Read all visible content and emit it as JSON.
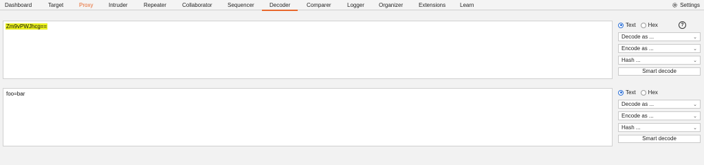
{
  "nav": {
    "tabs": [
      {
        "label": "Dashboard"
      },
      {
        "label": "Target"
      },
      {
        "label": "Proxy"
      },
      {
        "label": "Intruder"
      },
      {
        "label": "Repeater"
      },
      {
        "label": "Collaborator"
      },
      {
        "label": "Sequencer"
      },
      {
        "label": "Decoder"
      },
      {
        "label": "Comparer"
      },
      {
        "label": "Logger"
      },
      {
        "label": "Organizer"
      },
      {
        "label": "Extensions"
      },
      {
        "label": "Learn"
      }
    ],
    "active_tab": "Decoder",
    "settings_label": "Settings"
  },
  "colors": {
    "accent": "#e8672b",
    "highlight": "#e8ef1d",
    "radio": "#2b6fd6"
  },
  "panels": [
    {
      "content": "Zm9vPWJhcg==",
      "content_highlighted": true,
      "text_label": "Text",
      "hex_label": "Hex",
      "selected_mode": "Text",
      "help_label": "?",
      "decode_label": "Decode as ...",
      "encode_label": "Encode as ...",
      "hash_label": "Hash ...",
      "smart_decode_label": "Smart decode"
    },
    {
      "content": "foo=bar",
      "content_highlighted": false,
      "text_label": "Text",
      "hex_label": "Hex",
      "selected_mode": "Text",
      "decode_label": "Decode as ...",
      "encode_label": "Encode as ...",
      "hash_label": "Hash ...",
      "smart_decode_label": "Smart decode"
    }
  ]
}
